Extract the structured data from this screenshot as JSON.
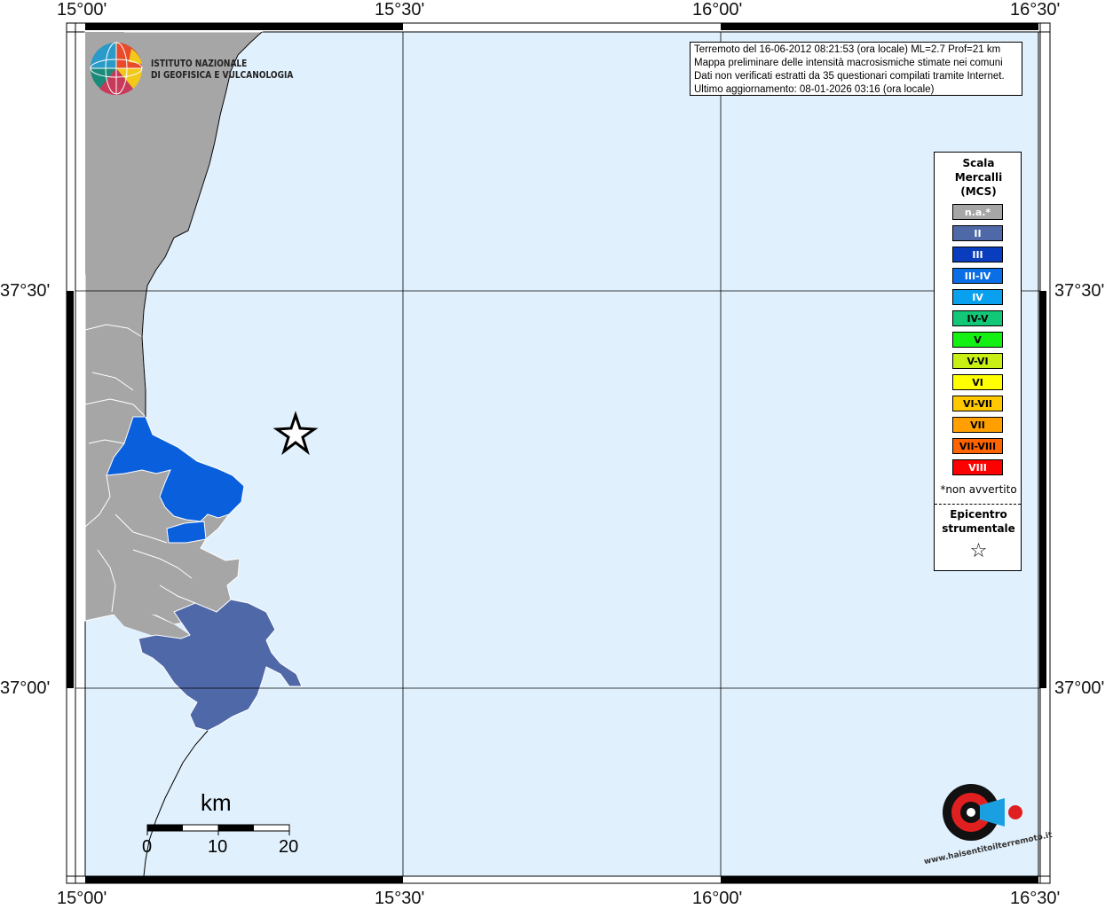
{
  "map": {
    "colors": {
      "sea": "#e0f0fc",
      "land_na": "#a6a6a6",
      "intensity_II": "#4f68a8",
      "intensity_III_IV": "#0a5fdc"
    },
    "coords": {
      "top": [
        "15°00'",
        "15°30'",
        "16°00'",
        "16°30'"
      ],
      "bottom": [
        "15°00'",
        "15°30'",
        "16°00'",
        "16°30'"
      ],
      "left": [
        "37°30'",
        "37°00'"
      ],
      "right": [
        "37°30'",
        "37°00'"
      ]
    }
  },
  "logo": {
    "line1": "ISTITUTO NAZIONALE",
    "line2": "DI GEOFISICA E VULCANOLOGIA"
  },
  "info": {
    "line1": "Terremoto del 16-06-2012 08:21:53 (ora locale) ML=2.7 Prof=21 km",
    "line2": "Mappa preliminare delle intensità macrosismiche stimate nei comuni",
    "line3": "Dati non verificati estratti da 35 questionari compilati tramite Internet.",
    "line4": "Ultimo aggiornamento: 08-01-2026 03:16 (ora locale)"
  },
  "legend": {
    "title1": "Scala",
    "title2": "Mercalli",
    "title3": "(MCS)",
    "items": [
      {
        "label": "n.a.*",
        "color": "#a6a6a6",
        "text_color": "#ffffff"
      },
      {
        "label": "II",
        "color": "#4f68a8",
        "text_color": "#ffffff"
      },
      {
        "label": "III",
        "color": "#0a3cbe",
        "text_color": "#ffffff"
      },
      {
        "label": "III-IV",
        "color": "#0a6ee6",
        "text_color": "#ffffff"
      },
      {
        "label": "IV",
        "color": "#0aa0f0",
        "text_color": "#ffffff"
      },
      {
        "label": "IV-V",
        "color": "#12c878",
        "text_color": "#000000"
      },
      {
        "label": "V",
        "color": "#14f014",
        "text_color": "#000000"
      },
      {
        "label": "V-VI",
        "color": "#c8f014",
        "text_color": "#000000"
      },
      {
        "label": "VI",
        "color": "#ffff00",
        "text_color": "#000000"
      },
      {
        "label": "VI-VII",
        "color": "#ffc800",
        "text_color": "#000000"
      },
      {
        "label": "VII",
        "color": "#ffa000",
        "text_color": "#000000"
      },
      {
        "label": "VII-VIII",
        "color": "#ff6400",
        "text_color": "#000000"
      },
      {
        "label": "VIII",
        "color": "#ff0000",
        "text_color": "#ffffff"
      }
    ],
    "note": "*non avvertito",
    "epicenter1": "Epicentro",
    "epicenter2": "strumentale",
    "epicenter_symbol": "☆"
  },
  "scalebar": {
    "unit": "km",
    "ticks": [
      "0",
      "10",
      "20"
    ]
  },
  "watermark": {
    "text": "www.haisentitoilterremoto.it"
  }
}
